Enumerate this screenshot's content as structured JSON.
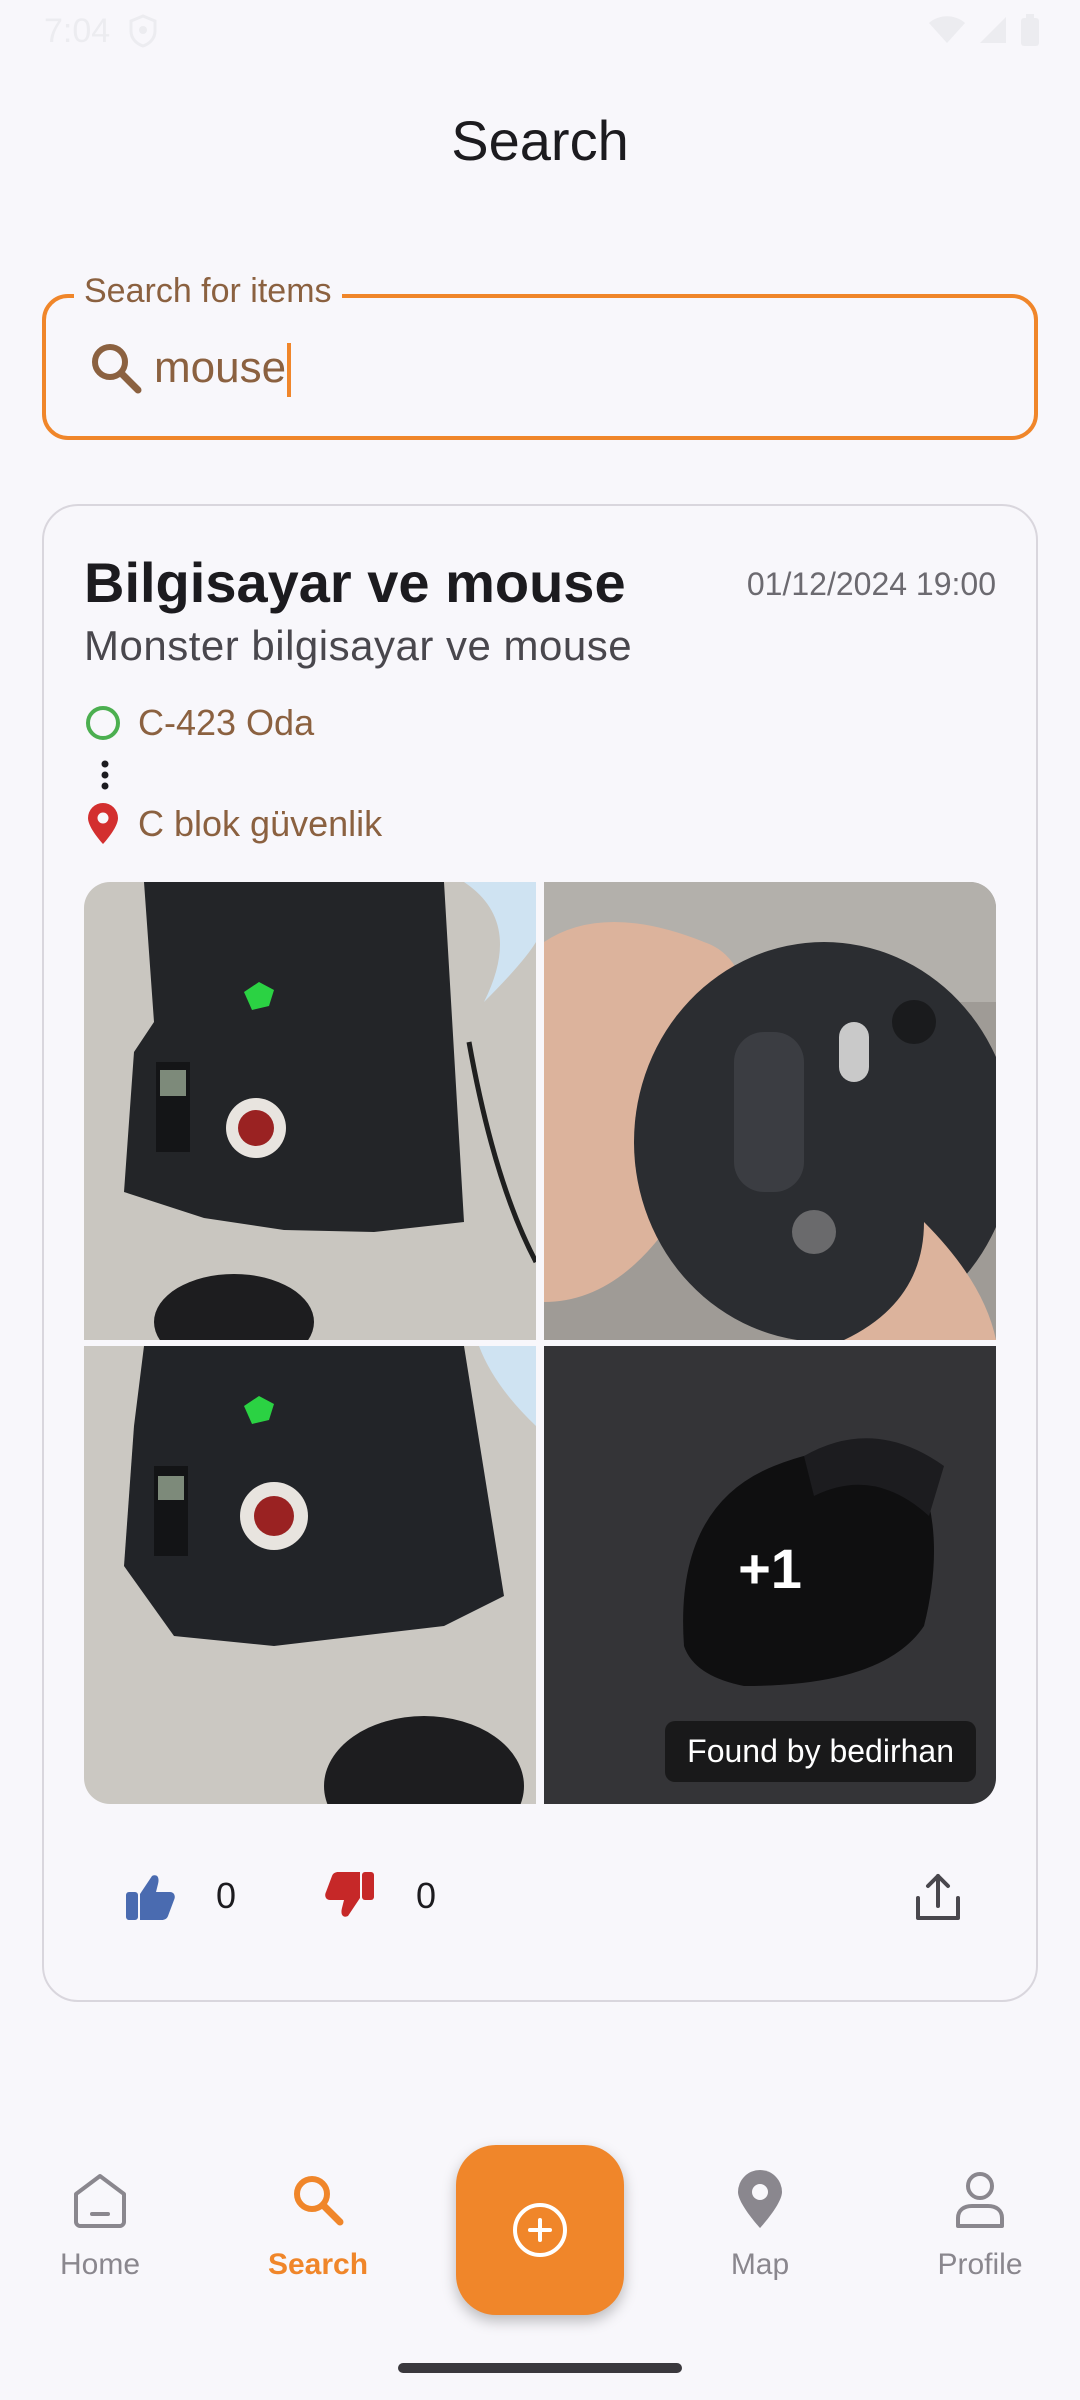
{
  "status_bar": {
    "time": "7:04"
  },
  "page": {
    "title": "Search"
  },
  "search": {
    "label": "Search for items",
    "value": "mouse"
  },
  "result": {
    "title": "Bilgisayar ve mouse",
    "date": "01/12/2024 19:00",
    "description": "Monster bilgisayar ve mouse",
    "from_location": "C-423 Oda",
    "to_location": "C blok güvenlik",
    "more_photos": "+1",
    "found_by": "Found by bedirhan",
    "likes": "0",
    "dislikes": "0"
  },
  "nav": {
    "home": "Home",
    "search": "Search",
    "map": "Map",
    "profile": "Profile"
  },
  "colors": {
    "accent": "#f0862a",
    "like": "#4a6bb0",
    "dislike": "#c62828",
    "from_marker": "#4caf50",
    "to_marker": "#d32f2f"
  }
}
